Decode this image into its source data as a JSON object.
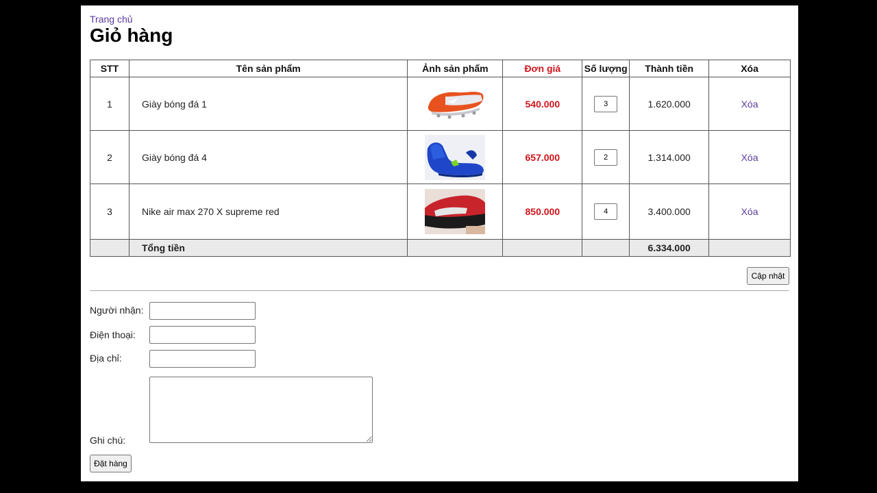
{
  "breadcrumb": {
    "home": "Trang chủ"
  },
  "page": {
    "title": "Giỏ hàng"
  },
  "cart": {
    "headers": {
      "stt": "STT",
      "name": "Tên sản phẩm",
      "image": "Ảnh sản phẩm",
      "price": "Đơn giá",
      "quantity": "Số lượng",
      "subtotal": "Thành tiền",
      "delete": "Xóa"
    },
    "rows": [
      {
        "stt": "1",
        "name": "Giày bóng đá 1",
        "image_alt": "orange-white-football-boot",
        "price": "540.000",
        "quantity": "3",
        "subtotal": "1.620.000",
        "delete": "Xóa"
      },
      {
        "stt": "2",
        "name": "Giày bóng đá 4",
        "image_alt": "blue-football-boot",
        "price": "657.000",
        "quantity": "2",
        "subtotal": "1.314.000",
        "delete": "Xóa"
      },
      {
        "stt": "3",
        "name": "Nike air max 270 X supreme  red",
        "image_alt": "red-black-sneaker",
        "price": "850.000",
        "quantity": "4",
        "subtotal": "3.400.000",
        "delete": "Xóa"
      }
    ],
    "total_label": "Tổng tiền",
    "total_value": "6.334.000",
    "update_button": "Cập nhật"
  },
  "form": {
    "recipient_label": "Người nhận:",
    "phone_label": "Điện thoại:",
    "address_label": "Địa chỉ:",
    "note_label": "Ghi chú:",
    "recipient_value": "",
    "phone_value": "",
    "address_value": "",
    "note_value": "",
    "submit_button": "Đặt hàng"
  },
  "colors": {
    "price": "#d0141c",
    "link": "#5b3a9e",
    "total_row_bg": "#eaeaea"
  }
}
